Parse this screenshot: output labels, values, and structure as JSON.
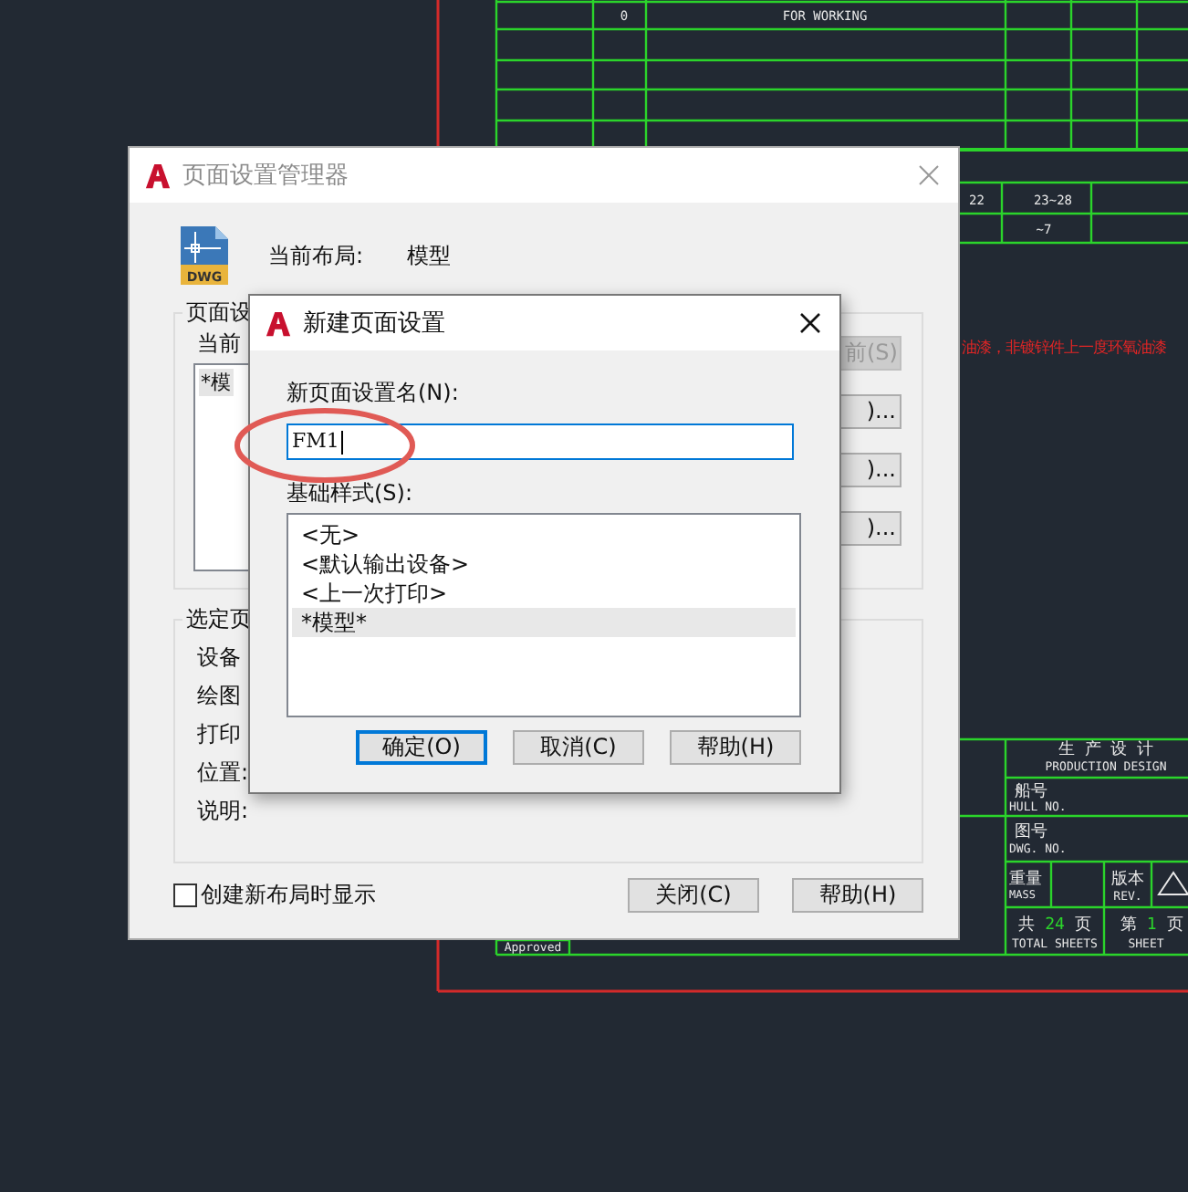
{
  "cad_drawing": {
    "revision": "0",
    "status": "FOR WORKING",
    "range_cells": [
      "22",
      "23~28",
      "~7"
    ],
    "note": "油漆，非镀锌件上一度环氧油漆",
    "approval_label": "Approved",
    "title_block": {
      "heading": "生 产 设 计",
      "heading_en": "PRODUCTION DESIGN",
      "hull_label": "船号",
      "hull_label_en": "HULL NO.",
      "drawing_no_label": "图号",
      "drawing_no_label_en": "DWG. NO.",
      "mass_label": "重量",
      "mass_label_en": "MASS",
      "revision_label": "版本",
      "revision_label_en": "REV.",
      "total_sheets": {
        "prefix": "共",
        "count": "24",
        "suffix": "页",
        "label_en": "TOTAL SHEETS"
      },
      "sheet": {
        "prefix": "第",
        "number": "1",
        "suffix": "页",
        "label_en": "SHEET"
      }
    }
  },
  "page_setup_manager": {
    "title": "页面设置管理器",
    "active": false,
    "file_type": "DWG",
    "current_layout_label": "当前布局:",
    "current_layout": "模型",
    "page_setups_group": "页面设",
    "current_setup_label": "当前",
    "setups": [
      {
        "label": "*模",
        "selected": true
      }
    ],
    "side_buttons": [
      {
        "label": "前(S)",
        "disabled": true
      },
      {
        "label": ")...",
        "disabled": false
      },
      {
        "label": ")...",
        "disabled": false
      },
      {
        "label": ")...",
        "disabled": false
      }
    ],
    "selected_group": "选定页",
    "details": [
      "设备",
      "绘图",
      "打印",
      "位置:",
      "说明:"
    ],
    "create_on_new_layout": {
      "label": "创建新布局时显示",
      "checked": false
    },
    "buttons": [
      "关闭(C)",
      "帮助(H)"
    ]
  },
  "new_page_setup": {
    "title": "新建页面设置",
    "active": true,
    "name_label": "新页面设置名(N):",
    "name_value": "FM1",
    "base_label": "基础样式(S):",
    "styles": [
      {
        "label": "<无>",
        "selected": false
      },
      {
        "label": "<默认输出设备>",
        "selected": false
      },
      {
        "label": "<上一次打印>",
        "selected": false
      },
      {
        "label": "*模型*",
        "selected": true
      }
    ],
    "buttons": [
      {
        "label": "确定(O)",
        "default": true
      },
      {
        "label": "取消(C)",
        "default": false
      },
      {
        "label": "帮助(H)",
        "default": false
      }
    ]
  }
}
